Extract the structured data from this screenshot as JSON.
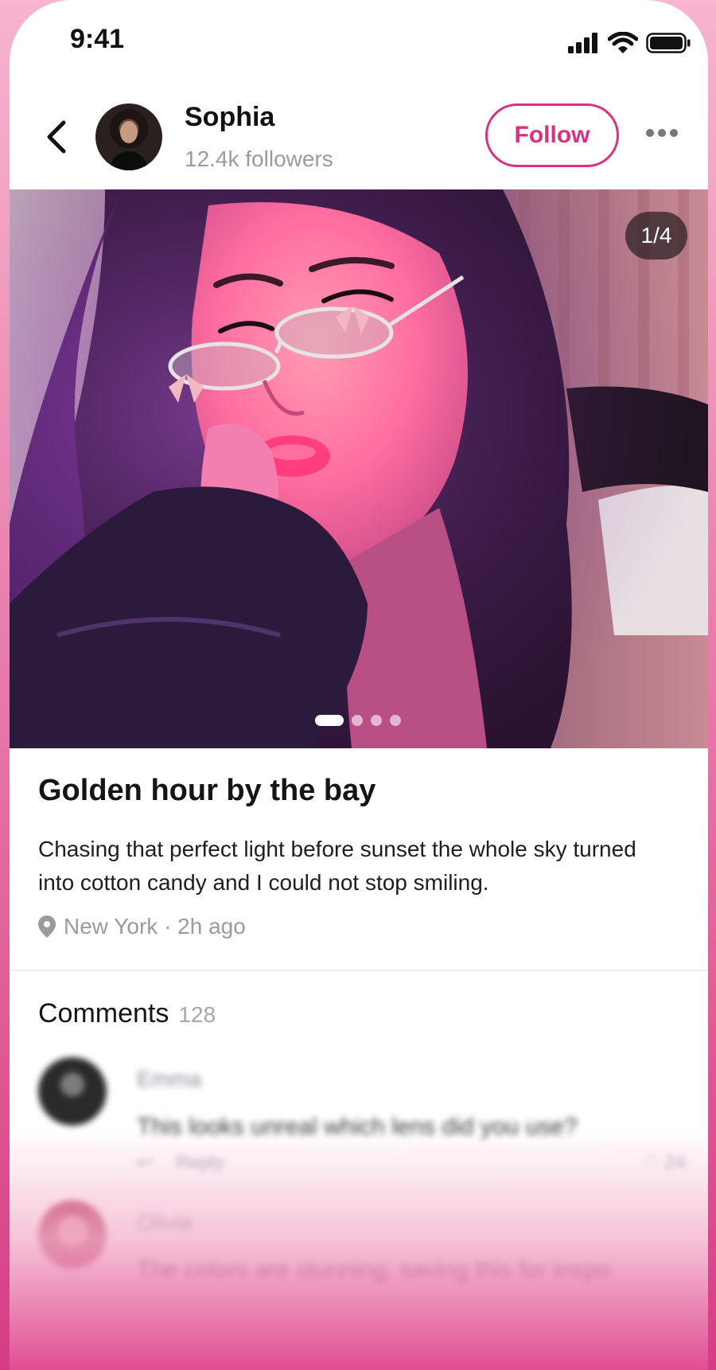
{
  "status_bar": {
    "time": "9:41"
  },
  "header": {
    "user_name": "Sophia",
    "followers": "12.4k followers",
    "follow_label": "Follow"
  },
  "photo": {
    "counter": "1/4",
    "total_slides": 4,
    "active_slide": 1
  },
  "post": {
    "title": "Golden hour by the bay",
    "body": "Chasing that perfect light before sunset the whole sky turned into cotton candy and I could not stop smiling.",
    "location": "New York",
    "time_ago": "2h ago",
    "meta": "New York · 2h ago"
  },
  "comments": {
    "title": "Comments",
    "count": "128",
    "items": [
      {
        "name": "Emma",
        "text": "This looks unreal which lens did you use?",
        "reply_label": "Reply",
        "likes": "24"
      },
      {
        "name": "Olivia",
        "text": "The colors are stunning, saving this for inspo"
      }
    ]
  },
  "colors": {
    "accent": "#d9317f",
    "muted_text": "#9a9aa4",
    "background_gradient_top": "#f7b5cf",
    "background_gradient_bottom": "#d63d86"
  }
}
